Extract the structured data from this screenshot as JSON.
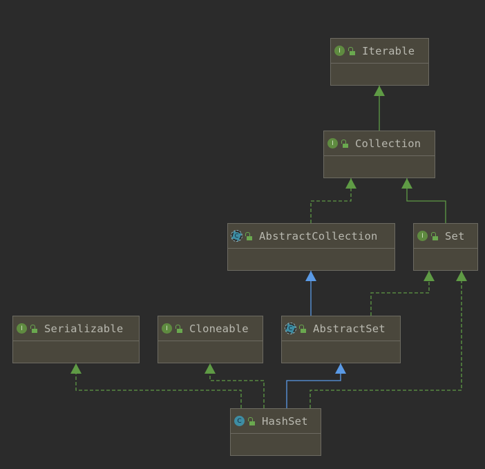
{
  "nodes": {
    "iterable": {
      "name": "Iterable",
      "kind": "I"
    },
    "collection": {
      "name": "Collection",
      "kind": "I"
    },
    "abstract_collection": {
      "name": "AbstractCollection",
      "kind": "C"
    },
    "set": {
      "name": "Set",
      "kind": "I"
    },
    "serializable": {
      "name": "Serializable",
      "kind": "I"
    },
    "cloneable": {
      "name": "Cloneable",
      "kind": "I"
    },
    "abstract_set": {
      "name": "AbstractSet",
      "kind": "C"
    },
    "hashset": {
      "name": "HashSet",
      "kind": "C"
    }
  },
  "colors": {
    "background": "#2b2b2b",
    "node_fill": "#4a473c",
    "implements_edge": "#5f9b45",
    "extends_edge": "#5a9ae6"
  },
  "edges": [
    {
      "from": "collection",
      "to": "iterable",
      "type": "extends-interface"
    },
    {
      "from": "abstract_collection",
      "to": "collection",
      "type": "implements"
    },
    {
      "from": "set",
      "to": "collection",
      "type": "extends-interface"
    },
    {
      "from": "abstract_set",
      "to": "abstract_collection",
      "type": "extends"
    },
    {
      "from": "abstract_set",
      "to": "set",
      "type": "implements"
    },
    {
      "from": "hashset",
      "to": "abstract_set",
      "type": "extends"
    },
    {
      "from": "hashset",
      "to": "set",
      "type": "implements"
    },
    {
      "from": "hashset",
      "to": "serializable",
      "type": "implements"
    },
    {
      "from": "hashset",
      "to": "cloneable",
      "type": "implements"
    }
  ]
}
